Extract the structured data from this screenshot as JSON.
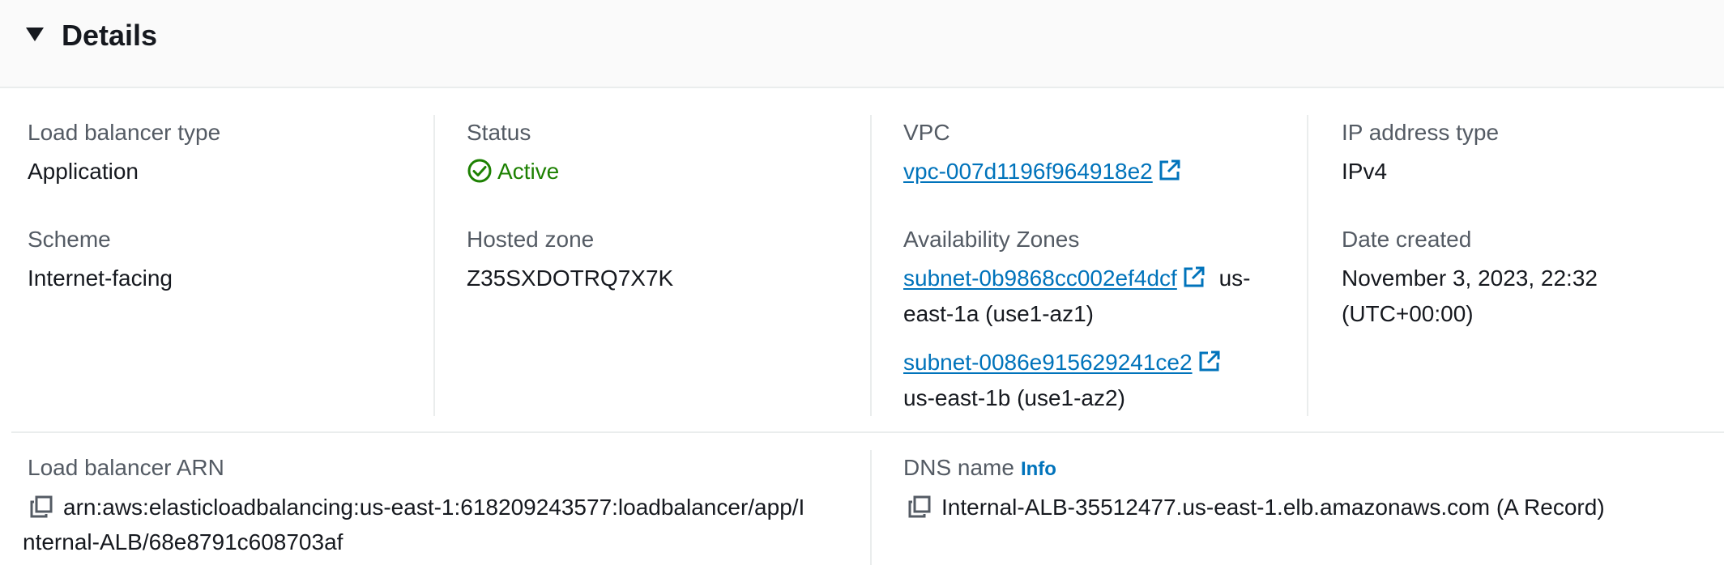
{
  "header": {
    "title": "Details"
  },
  "lb_type": {
    "label": "Load balancer type",
    "value": "Application"
  },
  "scheme": {
    "label": "Scheme",
    "value": "Internet-facing"
  },
  "status": {
    "label": "Status",
    "value": "Active",
    "color": "#1d8102"
  },
  "hosted_zone": {
    "label": "Hosted zone",
    "value": "Z35SXDOTRQ7X7K"
  },
  "vpc": {
    "label": "VPC",
    "link": "vpc-007d1196f964918e2"
  },
  "availability_zones": {
    "label": "Availability Zones",
    "items": [
      {
        "subnet": "subnet-0b9868cc002ef4dcf",
        "zone_line1": "us-",
        "zone_line2": "east-1a (use1-az1)"
      },
      {
        "subnet": "subnet-0086e915629241ce2",
        "zone_line1": "",
        "zone_line2": "us-east-1b (use1-az2)"
      }
    ]
  },
  "ip_type": {
    "label": "IP address type",
    "value": "IPv4"
  },
  "date_created": {
    "label": "Date created",
    "line1": "November 3, 2023, 22:32",
    "line2": "(UTC+00:00)"
  },
  "arn": {
    "label": "Load balancer ARN",
    "line1": "arn:aws:elasticloadbalancing:us-east-1:618209243577:loadbalancer/app/I",
    "line2": "nternal-ALB/68e8791c608703af"
  },
  "dns": {
    "label": "DNS name",
    "info": "Info",
    "value": "Internal-ALB-35512477.us-east-1.elb.amazonaws.com (A Record)"
  },
  "colors": {
    "link": "#0073bb",
    "label": "#545b64",
    "text": "#16191f",
    "success": "#1d8102"
  }
}
